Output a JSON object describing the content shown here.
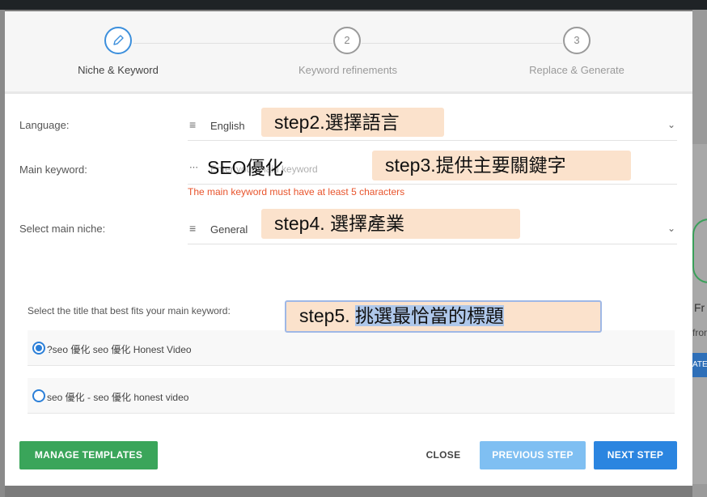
{
  "stepper": {
    "steps": [
      {
        "number": "",
        "label": "Niche & Keyword",
        "icon": "edit-icon"
      },
      {
        "number": "2",
        "label": "Keyword refinements"
      },
      {
        "number": "3",
        "label": "Replace & Generate"
      }
    ]
  },
  "form": {
    "language": {
      "label": "Language:",
      "value": "English"
    },
    "main_keyword": {
      "label": "Main keyword:",
      "placeholder": "Enter your main keyword",
      "error": "The main keyword must have at least 5 characters"
    },
    "niche": {
      "label": "Select main niche:",
      "value": "General"
    }
  },
  "titles": {
    "prompt": "Select the title that best fits your main keyword:",
    "options": [
      {
        "text": "?seo 優化 seo 優化 Honest Video",
        "checked": true
      },
      {
        "text": "seo 優化 - seo 優化 honest video",
        "checked": false
      }
    ]
  },
  "buttons": {
    "manage": "MANAGE TEMPLATES",
    "close": "CLOSE",
    "previous": "PREVIOUS STEP",
    "next": "NEXT STEP"
  },
  "annotations": {
    "step2": "step2.選擇語言",
    "step3": "step3.提供主要關鍵字",
    "step4": "step4. 選擇產業",
    "step5_prefix": "step5. ",
    "step5_highlight": "挑選最恰當的標題",
    "keyword_overlay": "SEO優化"
  },
  "background": {
    "right_text1": "Fr",
    "right_text2": "fron",
    "right_button": "ATE"
  },
  "colors": {
    "primary": "#2b85e0",
    "success": "#3aa55a",
    "error": "#e8542c",
    "note": "#fbe2cc"
  }
}
